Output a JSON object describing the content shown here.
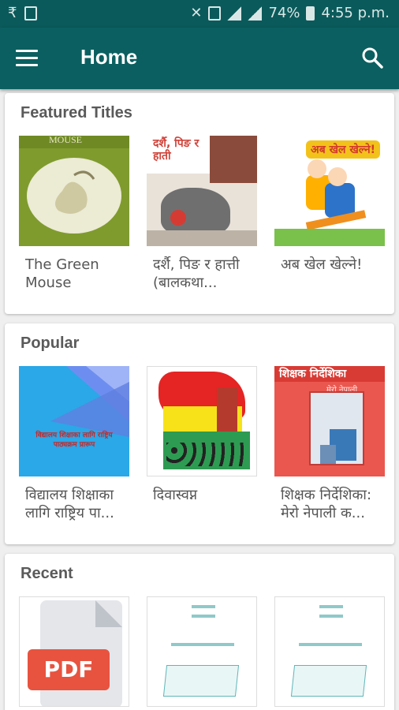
{
  "status": {
    "left_icons": [
      "₹",
      "clipboard-icon"
    ],
    "battery": "74%",
    "time": "4:55 p.m."
  },
  "appbar": {
    "title": "Home"
  },
  "sections": [
    {
      "title": "Featured Titles",
      "items": [
        {
          "caption": "The Green Mouse",
          "cover_text": "MOUSE"
        },
        {
          "caption": "दर्शै, पिङ र हात्ती (बालकथा...",
          "cover_text": "दर्शै, पिङ र हाती"
        },
        {
          "caption": "अब खेल खेल्ने!",
          "cover_text": "अब खेल खेल्ने!"
        }
      ]
    },
    {
      "title": "Popular",
      "items": [
        {
          "caption": "विद्यालय शिक्षाका लागि राष्ट्रिय पा...",
          "cover_text": "विद्यालय शिक्षाका लागि राष्ट्रिय पाठ्यक्रम प्रारूप"
        },
        {
          "caption": "दिवास्वप्न",
          "cover_text": ""
        },
        {
          "caption": "शिक्षक निर्देशिका: मेरो नेपाली क...",
          "cover_text": "शिक्षक निर्देशिका",
          "cover_subtext": "मेरो नेपाली"
        }
      ]
    },
    {
      "title": "Recent",
      "items": [
        {
          "caption": "",
          "cover_text": "PDF"
        },
        {
          "caption": "",
          "cover_text": ""
        },
        {
          "caption": "",
          "cover_text": ""
        }
      ]
    }
  ],
  "colors": {
    "appbar": "#0b5f60",
    "statusbar": "#0b5a5b",
    "pdf_badge": "#e8533f"
  }
}
